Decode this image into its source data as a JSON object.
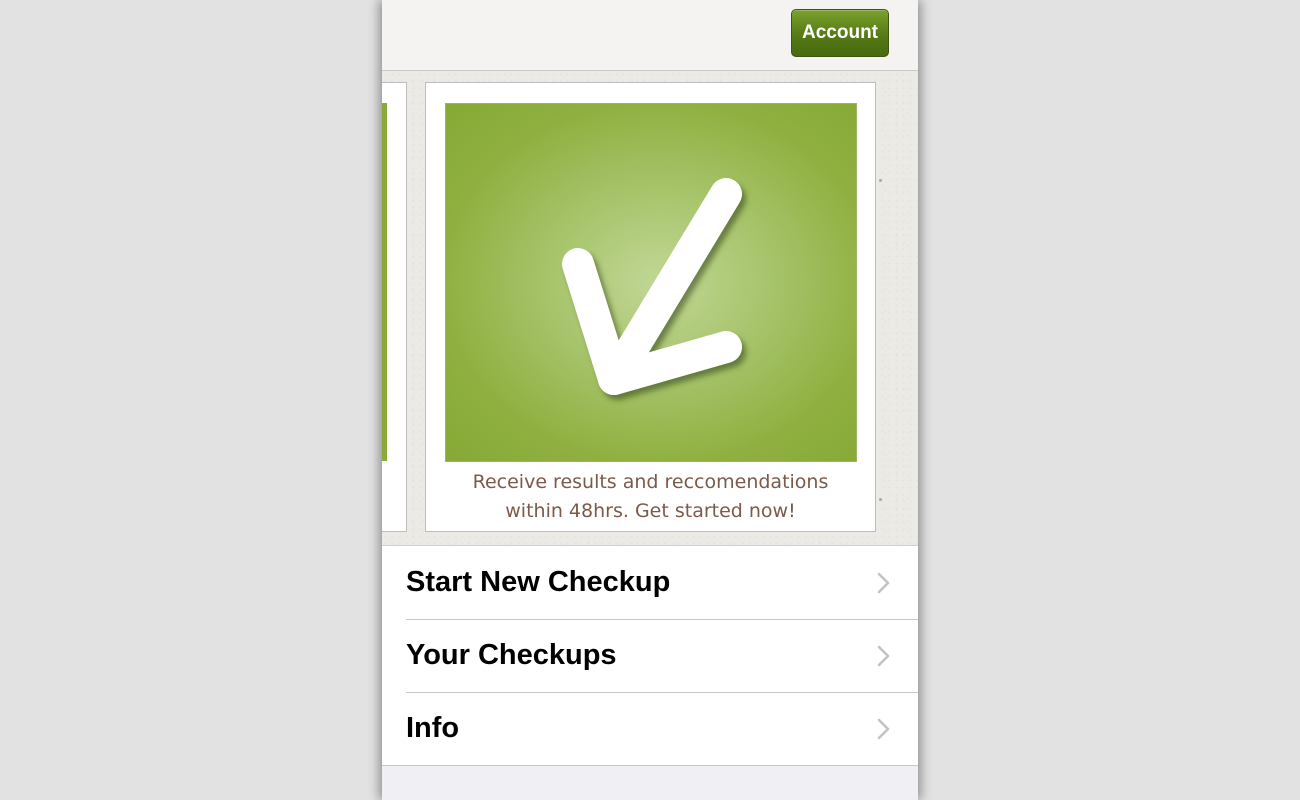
{
  "navbar": {
    "account_label": "Account"
  },
  "carousel": {
    "slide": {
      "caption_line1": "Receive results and reccomendations",
      "caption_line2": "within 48hrs. Get started now!",
      "art_icon": "checkmark-icon"
    }
  },
  "menu": {
    "items": [
      {
        "label": "Start New Checkup",
        "icon": "chevron-right-icon"
      },
      {
        "label": "Your Checkups",
        "icon": "chevron-right-icon"
      },
      {
        "label": "Info",
        "icon": "chevron-right-icon"
      }
    ]
  },
  "colors": {
    "accent_green": "#567a16",
    "caption_brown": "#7b5a4a",
    "background": "#e2e2e2"
  }
}
